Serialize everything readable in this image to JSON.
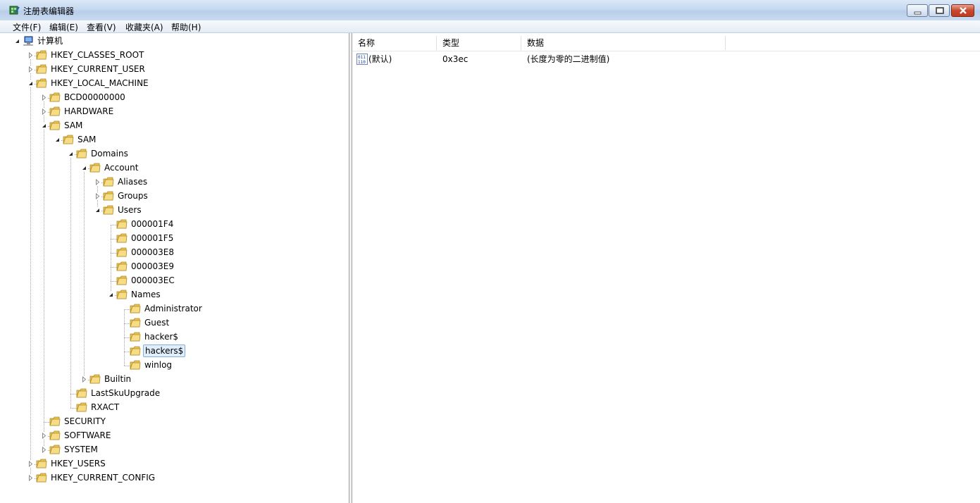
{
  "window": {
    "title": "注册表编辑器",
    "icon": "regedit-icon"
  },
  "menu": [
    "文件(F)",
    "编辑(E)",
    "查看(V)",
    "收藏夹(A)",
    "帮助(H)"
  ],
  "tree": [
    {
      "label": "计算机",
      "depth": 0,
      "state": "expanded",
      "icon": "computer-icon"
    },
    {
      "label": "HKEY_CLASSES_ROOT",
      "depth": 1,
      "state": "collapsed"
    },
    {
      "label": "HKEY_CURRENT_USER",
      "depth": 1,
      "state": "collapsed"
    },
    {
      "label": "HKEY_LOCAL_MACHINE",
      "depth": 1,
      "state": "expanded"
    },
    {
      "label": "BCD00000000",
      "depth": 2,
      "state": "collapsed"
    },
    {
      "label": "HARDWARE",
      "depth": 2,
      "state": "collapsed"
    },
    {
      "label": "SAM",
      "depth": 2,
      "state": "expanded"
    },
    {
      "label": "SAM",
      "depth": 3,
      "state": "expanded"
    },
    {
      "label": "Domains",
      "depth": 4,
      "state": "expanded"
    },
    {
      "label": "Account",
      "depth": 5,
      "state": "expanded"
    },
    {
      "label": "Aliases",
      "depth": 6,
      "state": "collapsed"
    },
    {
      "label": "Groups",
      "depth": 6,
      "state": "collapsed"
    },
    {
      "label": "Users",
      "depth": 6,
      "state": "expanded"
    },
    {
      "label": "000001F4",
      "depth": 7,
      "state": "leaf"
    },
    {
      "label": "000001F5",
      "depth": 7,
      "state": "leaf"
    },
    {
      "label": "000003E8",
      "depth": 7,
      "state": "leaf"
    },
    {
      "label": "000003E9",
      "depth": 7,
      "state": "leaf"
    },
    {
      "label": "000003EC",
      "depth": 7,
      "state": "leaf"
    },
    {
      "label": "Names",
      "depth": 7,
      "state": "expanded"
    },
    {
      "label": "Administrator",
      "depth": 8,
      "state": "leaf"
    },
    {
      "label": "Guest",
      "depth": 8,
      "state": "leaf"
    },
    {
      "label": "hacker$",
      "depth": 8,
      "state": "leaf"
    },
    {
      "label": "hackers$",
      "depth": 8,
      "state": "leaf",
      "selected": true
    },
    {
      "label": "winlog",
      "depth": 8,
      "state": "leaf"
    },
    {
      "label": "Builtin",
      "depth": 5,
      "state": "collapsed"
    },
    {
      "label": "LastSkuUpgrade",
      "depth": 4,
      "state": "leaf"
    },
    {
      "label": "RXACT",
      "depth": 4,
      "state": "leaf"
    },
    {
      "label": "SECURITY",
      "depth": 2,
      "state": "leaf"
    },
    {
      "label": "SOFTWARE",
      "depth": 2,
      "state": "collapsed"
    },
    {
      "label": "SYSTEM",
      "depth": 2,
      "state": "collapsed"
    },
    {
      "label": "HKEY_USERS",
      "depth": 1,
      "state": "collapsed"
    },
    {
      "label": "HKEY_CURRENT_CONFIG",
      "depth": 1,
      "state": "collapsed"
    }
  ],
  "list": {
    "columns": [
      "名称",
      "类型",
      "数据"
    ],
    "rows": [
      {
        "name": "(默认)",
        "type": "0x3ec",
        "data": "(长度为零的二进制值)",
        "icon": "binary-value-icon"
      }
    ]
  },
  "colors": {
    "folder": "#e8c352",
    "selection": "#dfeefc",
    "selection_border": "#84acdd"
  }
}
